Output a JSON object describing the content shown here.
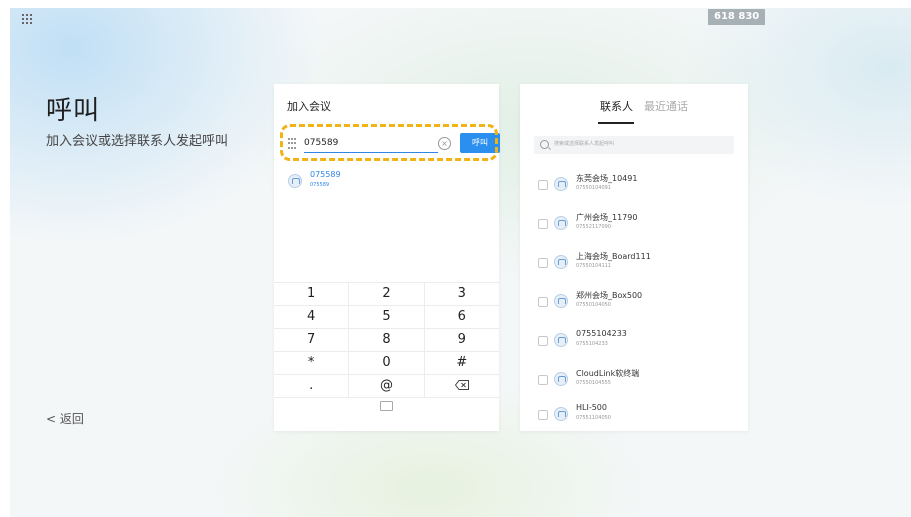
{
  "header": {
    "extension_badge": "618 830"
  },
  "page": {
    "title": "呼叫",
    "subtitle": "加入会议或选择联系人发起呼叫",
    "back_label": "< 返回"
  },
  "join": {
    "title": "加入会议",
    "input_value": "075589",
    "call_button": "呼叫",
    "suggestion": {
      "name": "075589",
      "number": "075589"
    },
    "keypad": [
      [
        "1",
        "2",
        "3"
      ],
      [
        "4",
        "5",
        "6"
      ],
      [
        "7",
        "8",
        "9"
      ],
      [
        "*",
        "0",
        "#"
      ],
      [
        ".",
        "@",
        "backspace"
      ]
    ]
  },
  "contacts_panel": {
    "tabs": [
      "联系人",
      "最近通话"
    ],
    "active_tab": "联系人",
    "search_placeholder": "搜索或选择联系人发起呼叫",
    "items": [
      {
        "name": "东莞会场_10491",
        "number": "07550104091"
      },
      {
        "name": "广州会场_11790",
        "number": "07552117090"
      },
      {
        "name": "上海会场_Board111",
        "number": "07550104111"
      },
      {
        "name": "郑州会场_Box500",
        "number": "07550104050"
      },
      {
        "name": "0755104233",
        "number": "0755104233"
      },
      {
        "name": "CloudLink软终端",
        "number": "07550104555"
      },
      {
        "name": "HLI-500",
        "number": "07551104050"
      }
    ]
  },
  "colors": {
    "accent": "#2b8ff0",
    "highlight": "#f0b214"
  }
}
